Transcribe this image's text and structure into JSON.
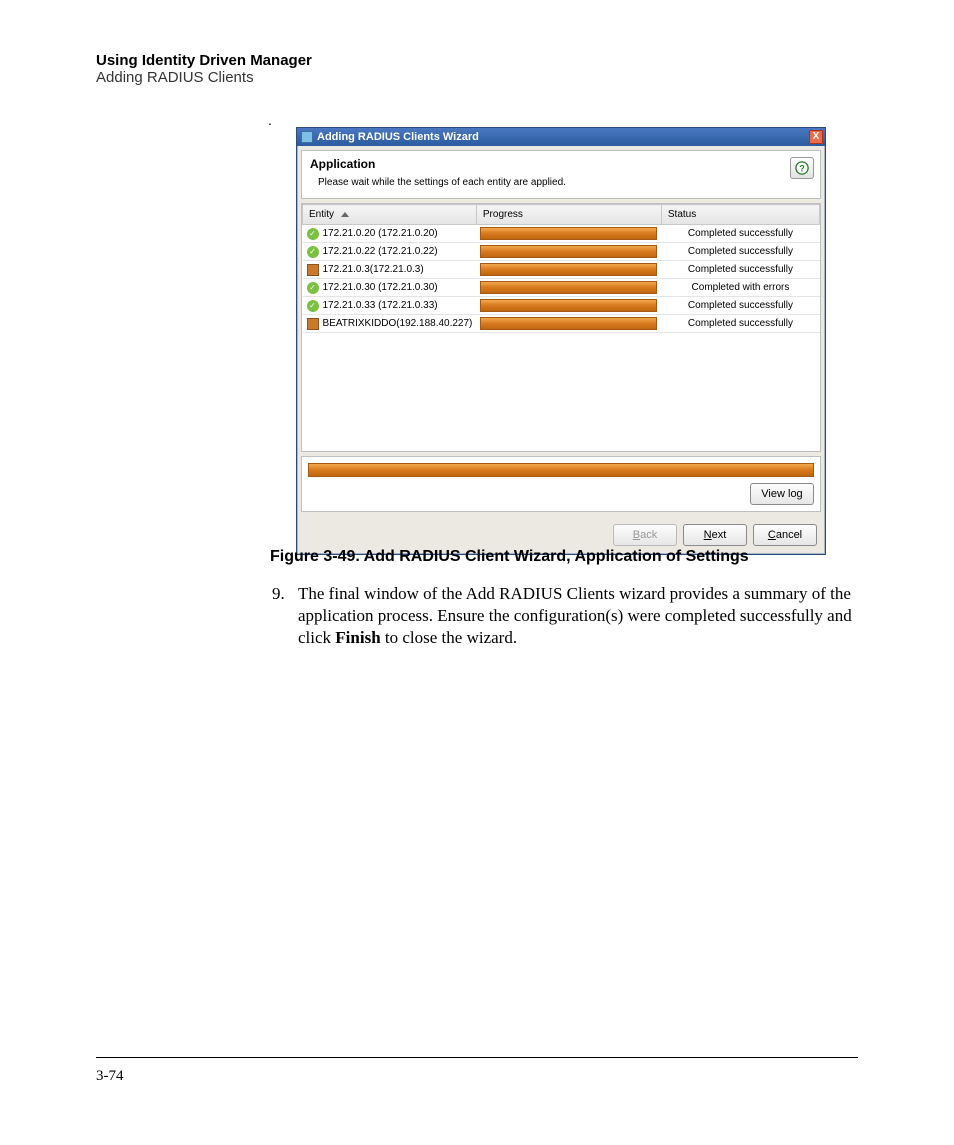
{
  "header": {
    "title": "Using Identity Driven Manager",
    "subtitle": "Adding RADIUS Clients"
  },
  "wizard": {
    "window_title": "Adding RADIUS Clients Wizard",
    "section_title": "Application",
    "section_message": "Please wait while the settings of each entity are applied.",
    "columns": {
      "entity": "Entity",
      "progress": "Progress",
      "status": "Status"
    },
    "rows": [
      {
        "icon": "ok",
        "entity": "172.21.0.20 (172.21.0.20)",
        "status": "Completed successfully"
      },
      {
        "icon": "ok",
        "entity": "172.21.0.22 (172.21.0.22)",
        "status": "Completed successfully"
      },
      {
        "icon": "dev",
        "entity": "172.21.0.3(172.21.0.3)",
        "status": "Completed successfully"
      },
      {
        "icon": "ok",
        "entity": "172.21.0.30 (172.21.0.30)",
        "status": "Completed with errors"
      },
      {
        "icon": "ok",
        "entity": "172.21.0.33 (172.21.0.33)",
        "status": "Completed successfully"
      },
      {
        "icon": "dev",
        "entity": "BEATRIXKIDDO(192.188.40.227)",
        "status": "Completed successfully"
      }
    ],
    "buttons": {
      "view_log": "View log",
      "back": "Back",
      "next": "Next",
      "cancel": "Cancel"
    }
  },
  "figure_caption": "Figure 3-49. Add RADIUS Client Wizard, Application of Settings",
  "body": {
    "number": "9.",
    "text_before_bold": "The final window of the Add RADIUS Clients wizard provides a summary of the application process. Ensure the configuration(s) were completed successfully and click ",
    "bold": "Finish",
    "text_after_bold": " to close the wizard."
  },
  "page_number": "3-74",
  "close_x": "X"
}
